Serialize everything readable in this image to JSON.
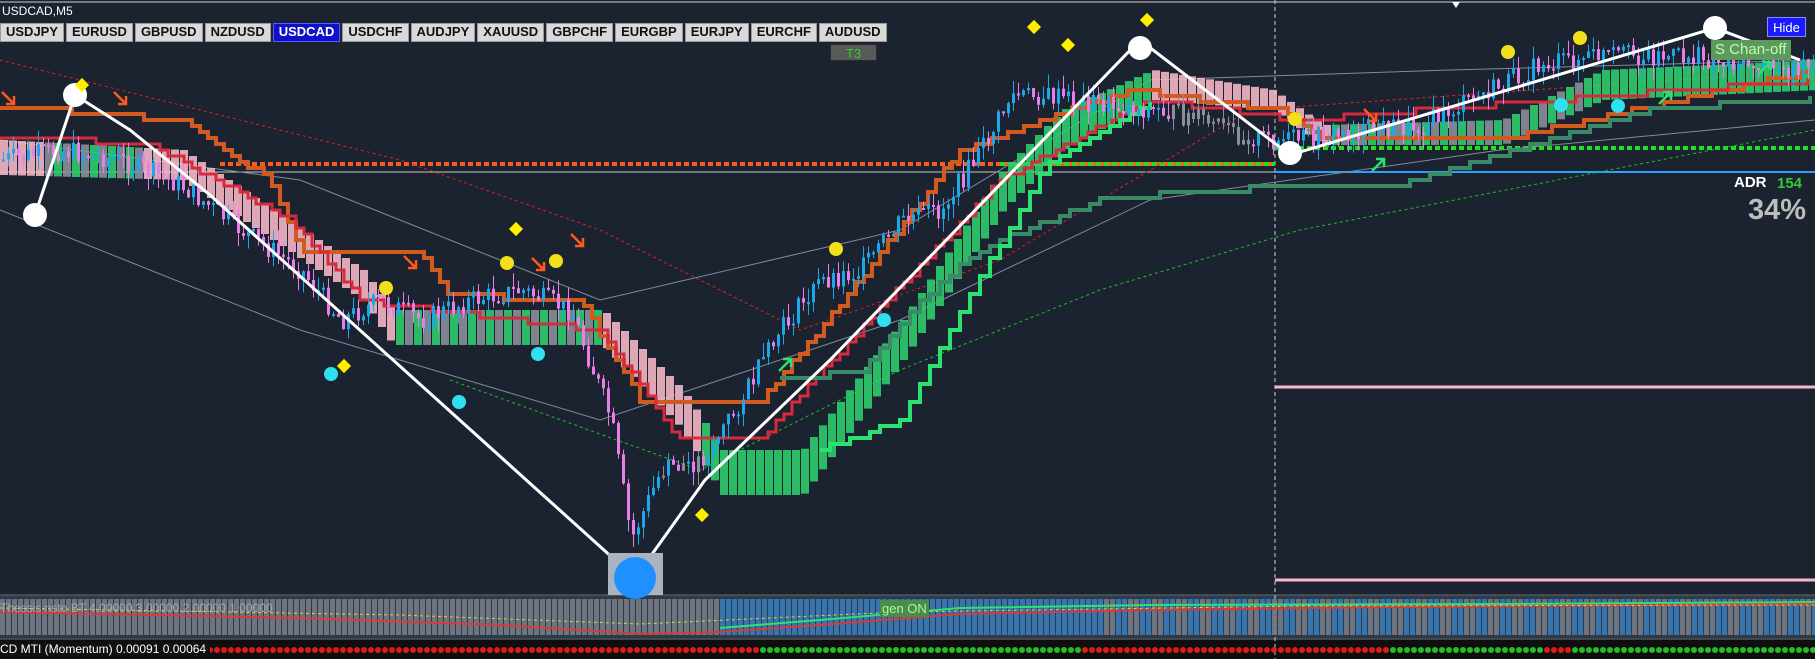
{
  "window": {
    "title": "USDCAD,M5"
  },
  "symbols": [
    {
      "label": "USDJPY",
      "active": false
    },
    {
      "label": "EURUSD",
      "active": false
    },
    {
      "label": "GBPUSD",
      "active": false
    },
    {
      "label": "NZDUSD",
      "active": false
    },
    {
      "label": "USDCAD",
      "active": true
    },
    {
      "label": "USDCHF",
      "active": false
    },
    {
      "label": "AUDJPY",
      "active": false
    },
    {
      "label": "XAUUSD",
      "active": false
    },
    {
      "label": "GBPCHF",
      "active": false
    },
    {
      "label": "EURGBP",
      "active": false
    },
    {
      "label": "EURJPY",
      "active": false
    },
    {
      "label": "EURCHF",
      "active": false
    },
    {
      "label": "AUDUSD",
      "active": false
    }
  ],
  "controls": {
    "t3_label": "T3",
    "hide_label": "Hide",
    "chan_label": "S Chan-off"
  },
  "adr": {
    "label": "ADR",
    "value": "154",
    "percent": "34%"
  },
  "indicator1": {
    "label": "Thessis nsto BT 4.00000 3.00000 2.00000 1.00000",
    "tag": "gen ON"
  },
  "indicator2": {
    "label": "CD MTI (Momentum) 0.00091 0.00064"
  },
  "colors": {
    "background": "#1b2230",
    "bull_candle": "#1ea7e8",
    "bear_candle": "#e87ee8",
    "cloud_green": "#2ecc6e",
    "cloud_pink": "#f4b6c4",
    "orange_line": "#d05a20",
    "dark_green_line": "#3a8a68",
    "white_zigzag": "#ffffff",
    "support_green": "#20e020",
    "resistance_orange": "#ff5a1a",
    "blue_level": "#2aa0ff",
    "pink_level": "#f5b8c8",
    "active_tab": "#1010c8"
  }
}
